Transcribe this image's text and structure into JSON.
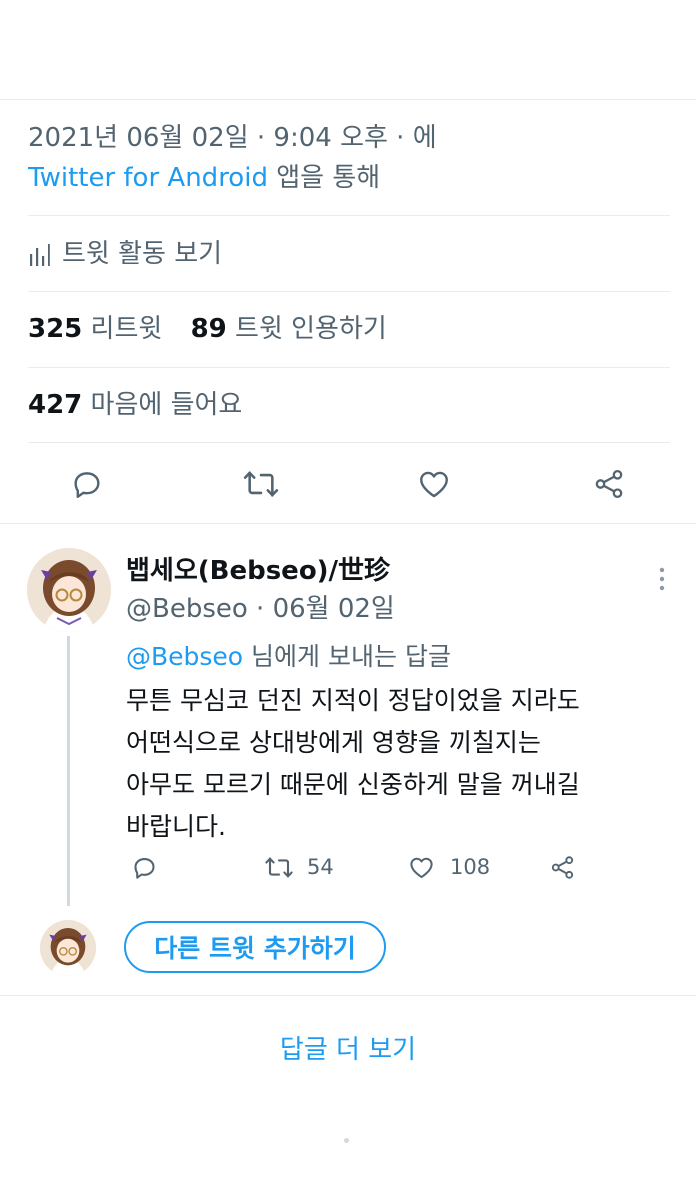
{
  "tweet_meta": {
    "timestamp": "2021년 06월 02일 · 9:04 오후 · 에",
    "source_app": "Twitter for Android",
    "source_suffix": " 앱을 통해"
  },
  "activity": {
    "label": "트윗 활동 보기",
    "icon": "analytics-icon"
  },
  "stats": {
    "retweets_count": "325",
    "retweets_label": "리트윗",
    "quotes_count": "89",
    "quotes_label": "트윗 인용하기",
    "likes_count": "427",
    "likes_label": "마음에 들어요"
  },
  "actions": [
    "reply-icon",
    "retweet-icon",
    "like-icon",
    "share-icon"
  ],
  "reply": {
    "display_name": "뱁세오(Bebseo)/世珍",
    "handle_date": "@Bebseo · 06월 02일",
    "replying_to_handle": "@Bebseo",
    "replying_to_suffix": " 님에게 보내는 답글",
    "lines": [
      "무튼 무심코 던진 지적이 정답이었을 지라도",
      "어떤식으로 상대방에게 영향을 끼칠지는",
      "아무도 모르기 때문에 신중하게 말을 꺼내길",
      "바랍니다."
    ],
    "retweet_count": "54",
    "like_count": "108"
  },
  "add_tweet_button": "다른 트윗 추가하기",
  "more_replies": "답글 더 보기",
  "colors": {
    "accent": "#1d9bf0",
    "muted": "#536471",
    "divider": "#e6ecf0"
  }
}
